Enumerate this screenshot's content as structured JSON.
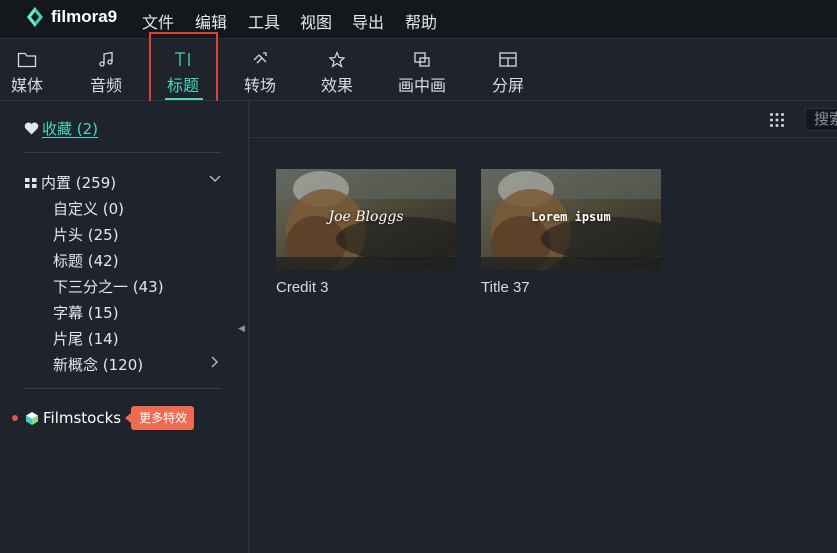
{
  "app": {
    "name": "filmora9"
  },
  "menu": [
    "文件",
    "编辑",
    "工具",
    "视图",
    "导出",
    "帮助"
  ],
  "toolbar": {
    "tabs": [
      {
        "label": "媒体",
        "icon": "folder-icon"
      },
      {
        "label": "音频",
        "icon": "music-note-icon"
      },
      {
        "label": "标题",
        "icon": "text-title-icon"
      },
      {
        "label": "转场",
        "icon": "transition-icon"
      },
      {
        "label": "效果",
        "icon": "effects-icon"
      },
      {
        "label": "画中画",
        "icon": "pip-icon"
      },
      {
        "label": "分屏",
        "icon": "split-screen-icon"
      }
    ],
    "active": "标题"
  },
  "sidebar": {
    "favorites": "收藏 (2)",
    "category": "内置 (259)",
    "items": [
      {
        "label": "自定义 (0)"
      },
      {
        "label": "片头 (25)"
      },
      {
        "label": "标题 (42)"
      },
      {
        "label": "下三分之一 (43)"
      },
      {
        "label": "字幕 (15)"
      },
      {
        "label": "片尾 (14)"
      },
      {
        "label": "新概念 (120)"
      }
    ],
    "filmstocks": "Filmstocks",
    "filmstocks_badge": "更多特效"
  },
  "main": {
    "search_placeholder": "搜索",
    "cards": [
      {
        "name": "Credit 3",
        "overlay_text": "Joe Bloggs"
      },
      {
        "name": "Title 37",
        "overlay_text": "Lorem ipsum"
      }
    ]
  },
  "colors": {
    "accent": "#47d7c3",
    "highlight": "#e0413b",
    "badge": "#ee6a52",
    "background": "#1f232b",
    "menubar": "#14171c"
  }
}
